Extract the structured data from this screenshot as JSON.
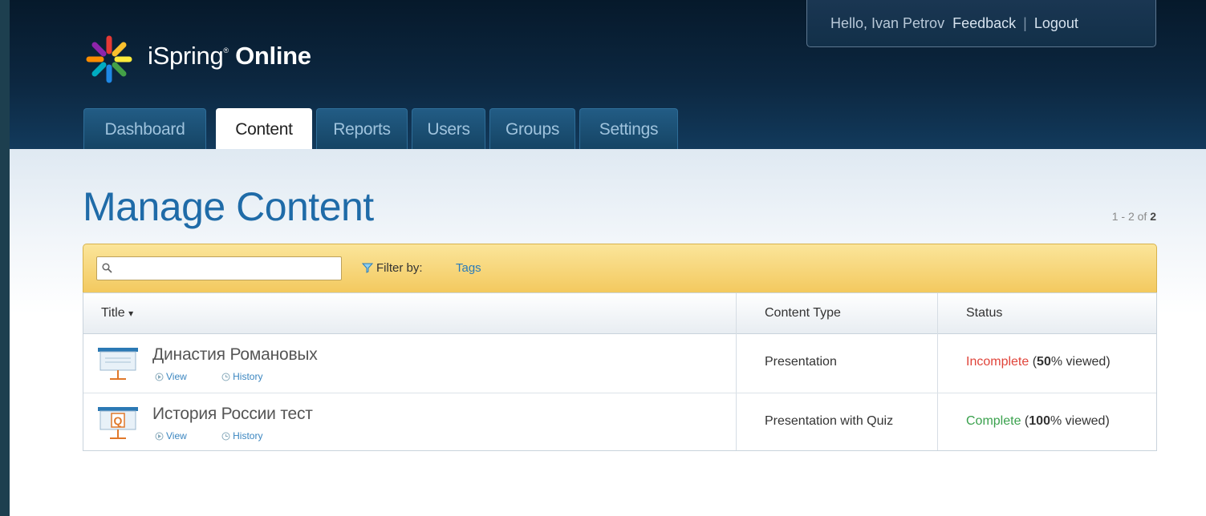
{
  "header": {
    "greeting": "Hello, Ivan Petrov",
    "feedback": "Feedback",
    "separator": "|",
    "logout": "Logout",
    "logo_text": "iSpring",
    "logo_bold": "Online"
  },
  "tabs": [
    {
      "label": "Dashboard",
      "active": false
    },
    {
      "label": "Content",
      "active": true
    },
    {
      "label": "Reports",
      "active": false
    },
    {
      "label": "Users",
      "active": false
    },
    {
      "label": "Groups",
      "active": false
    },
    {
      "label": "Settings",
      "active": false
    }
  ],
  "page": {
    "title": "Manage Content",
    "pager_range": "1 - 2 of",
    "pager_total": "2"
  },
  "filter": {
    "search_value": "",
    "filter_by_label": "Filter by:",
    "tags_link": "Tags"
  },
  "table": {
    "columns": {
      "title": "Title",
      "sort_indicator": "▾",
      "content_type": "Content Type",
      "status": "Status"
    },
    "rows": [
      {
        "title": "Династия Романовых",
        "view": "View",
        "history": "History",
        "content_type": "Presentation",
        "status_word": "Incomplete",
        "status_open": " (",
        "percent": "50",
        "status_rest": "% viewed)",
        "icon": "presentation-icon"
      },
      {
        "title": "История России тест",
        "view": "View",
        "history": "History",
        "content_type": "Presentation with Quiz",
        "status_word": "Complete",
        "status_open": " (",
        "percent": "100",
        "status_rest": "% viewed)",
        "icon": "quiz-presentation-icon"
      }
    ]
  },
  "colors": {
    "header_bg": "#0c2740",
    "title_blue": "#1f6ba8",
    "link_blue": "#2b7cb9",
    "incomplete": "#e0443a",
    "complete": "#3aa14d",
    "filter_bar": "#f3c95f"
  }
}
